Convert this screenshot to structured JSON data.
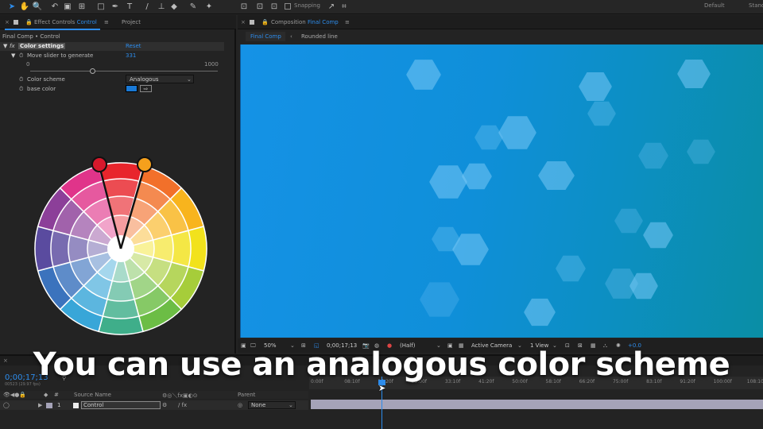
{
  "toolbar": {
    "snapping_label": "Snapping",
    "workspace_default": "Default",
    "workspace_standard": "Stand"
  },
  "effect_panel": {
    "tab_title": "Effect Controls",
    "tab_layer": "Control",
    "project_tab": "Project",
    "breadcrumb": "Final Comp • Control",
    "fx_label": "fx",
    "group_name": "Color settings",
    "reset_label": "Reset",
    "slider_label": "Move slider to generate",
    "slider_value": "331",
    "slider_min": "0",
    "slider_max": "1000",
    "slider_fraction": 0.331,
    "scheme_label": "Color scheme",
    "scheme_value": "Analogous",
    "base_color_label": "base color",
    "base_color_hex": "#1979d6"
  },
  "composition_panel": {
    "tab_title": "Composition",
    "tab_comp": "Final Comp",
    "comp_tab": "Final Comp",
    "rounded_tab": "Rounded line",
    "zoom": "50%",
    "timecode": "0;00;17;13",
    "resolution": "(Half)",
    "camera": "Active Camera",
    "view": "1 View",
    "exposure": "+0.0"
  },
  "timeline": {
    "current_time": "0;00;17;13",
    "fps_note": "00523 (29.97 fps)",
    "col_source_name": "Source Name",
    "col_parent": "Parent",
    "layer_number": "1",
    "layer_name": "Control",
    "parent_value": "None",
    "ruler_ticks": [
      "0:00f",
      "08:10f",
      "16:20f",
      "25:00f",
      "33:10f",
      "41:20f",
      "50:00f",
      "58:10f",
      "66:20f",
      "75:00f",
      "83:10f",
      "91:20f",
      "100:00f",
      "108:10f"
    ]
  },
  "caption": "You can use an analogous color scheme",
  "colors": {
    "accent_blue": "#2d8ceb",
    "handle_red": "#d7192c",
    "handle_orange": "#f5a01c"
  }
}
